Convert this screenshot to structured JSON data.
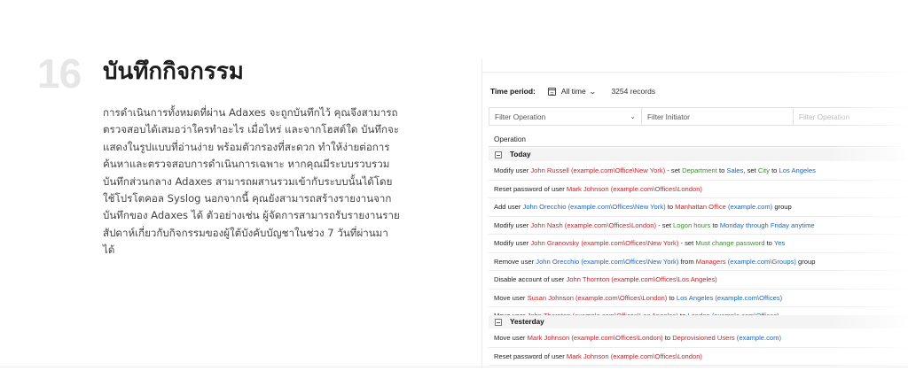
{
  "section": {
    "number": "16",
    "title": "บันทึกกิจกรรม",
    "description_lines": [
      "การดำเนินการทั้งหมดที่ผ่าน Adaxes จะถูกบันทึกไว้ คุณจึงสามารถ",
      "ตรวจสอบได้เสมอว่าใครทำอะไร เมื่อไหร่ และจากโฮสต์ใด บันทึกจะ",
      "แสดงในรูปแบบที่อ่านง่าย พร้อมตัวกรองที่สะดวก ทำให้ง่ายต่อการ",
      "ค้นหาและตรวจสอบการดำเนินการเฉพาะ หากคุณมีระบบรวบรวม",
      "บันทึกส่วนกลาง Adaxes สามารถผสานรวมเข้ากับระบบนั้นได้โดย",
      "ใช้โปรโตคอล Syslog นอกจากนี้ คุณยังสามารถสร้างรายงานจาก",
      "บันทึกของ Adaxes ได้ ตัวอย่างเช่น ผู้จัดการสามารถรับรายงานราย",
      "สัปดาห์เกี่ยวกับกิจกรรมของผู้ใต้บังคับบัญชาในช่วง 7 วันที่ผ่านมา",
      "ได้"
    ]
  },
  "screenshot": {
    "time_period_label": "Time period:",
    "time_period_value": "All time",
    "records": "3254 records",
    "filters": [
      "Filter Operation",
      "Filter Initiator",
      "Filter Operation"
    ],
    "column_header": "Operation",
    "groups": [
      "Today",
      "Yesterday"
    ],
    "rows_today": [
      [
        [
          "k",
          "Modify user "
        ],
        [
          "r",
          "John Russell (example.com\\Office\\New York)"
        ],
        [
          "k",
          " - set "
        ],
        [
          "g",
          "Department"
        ],
        [
          "k",
          " to "
        ],
        [
          "b",
          "Sales"
        ],
        [
          "k",
          ", set "
        ],
        [
          "g",
          "City"
        ],
        [
          "k",
          " to "
        ],
        [
          "b",
          "Los Angeles"
        ]
      ],
      [
        [
          "k",
          "Reset password of user "
        ],
        [
          "r",
          "Mark Johnson (example.com\\Offices\\London)"
        ]
      ],
      [
        [
          "k",
          "Add user "
        ],
        [
          "b",
          "John Orecchio (example.com\\Offices\\New York)"
        ],
        [
          "k",
          " to "
        ],
        [
          "r",
          "Manhattan Office"
        ],
        [
          "b",
          " (example.com)"
        ],
        [
          "k",
          " group"
        ]
      ],
      [
        [
          "k",
          "Modify user "
        ],
        [
          "r",
          "John Nash (example.com\\Offices\\London)"
        ],
        [
          "k",
          " - set "
        ],
        [
          "g",
          "Logon hours"
        ],
        [
          "k",
          " to "
        ],
        [
          "b",
          "Monday through Friday anytime"
        ]
      ],
      [
        [
          "k",
          "Modify user "
        ],
        [
          "r",
          "John Granovsky (example.com\\Offices\\New York)"
        ],
        [
          "k",
          " - set "
        ],
        [
          "g",
          "Must change password"
        ],
        [
          "k",
          " to "
        ],
        [
          "b",
          "Yes"
        ]
      ],
      [
        [
          "k",
          "Remove user "
        ],
        [
          "b",
          "John Orecchio (example.com\\Offices\\New York)"
        ],
        [
          "k",
          " from "
        ],
        [
          "r",
          "Managers"
        ],
        [
          "b",
          " (example.com\\Groups)"
        ],
        [
          "k",
          " group"
        ]
      ],
      [
        [
          "k",
          "Disable account of user "
        ],
        [
          "r",
          "John Thornton (example.com\\Offices\\Los Angeles)"
        ]
      ],
      [
        [
          "k",
          "Move user "
        ],
        [
          "r",
          "Susan Johnson (example.com\\Offices\\London)"
        ],
        [
          "k",
          " to "
        ],
        [
          "b",
          "Los Angeles (example.com\\Offices)"
        ]
      ],
      [
        [
          "k",
          "Move user "
        ],
        [
          "r",
          "John Thornton (example.com\\Offices\\Los Angeles)"
        ],
        [
          "k",
          " to "
        ],
        [
          "b",
          "London (example.com\\Offices)"
        ]
      ]
    ],
    "rows_yesterday": [
      [
        [
          "k",
          "Move user "
        ],
        [
          "r",
          "Mark Johnson (example.com\\Offices\\London)"
        ],
        [
          "k",
          " to "
        ],
        [
          "r",
          "Deprovisioned Users"
        ],
        [
          "b",
          " (example.com)"
        ]
      ],
      [
        [
          "k",
          "Reset password of user "
        ],
        [
          "r",
          "Mark Johnson (example.com\\Offices\\London)"
        ]
      ]
    ]
  }
}
